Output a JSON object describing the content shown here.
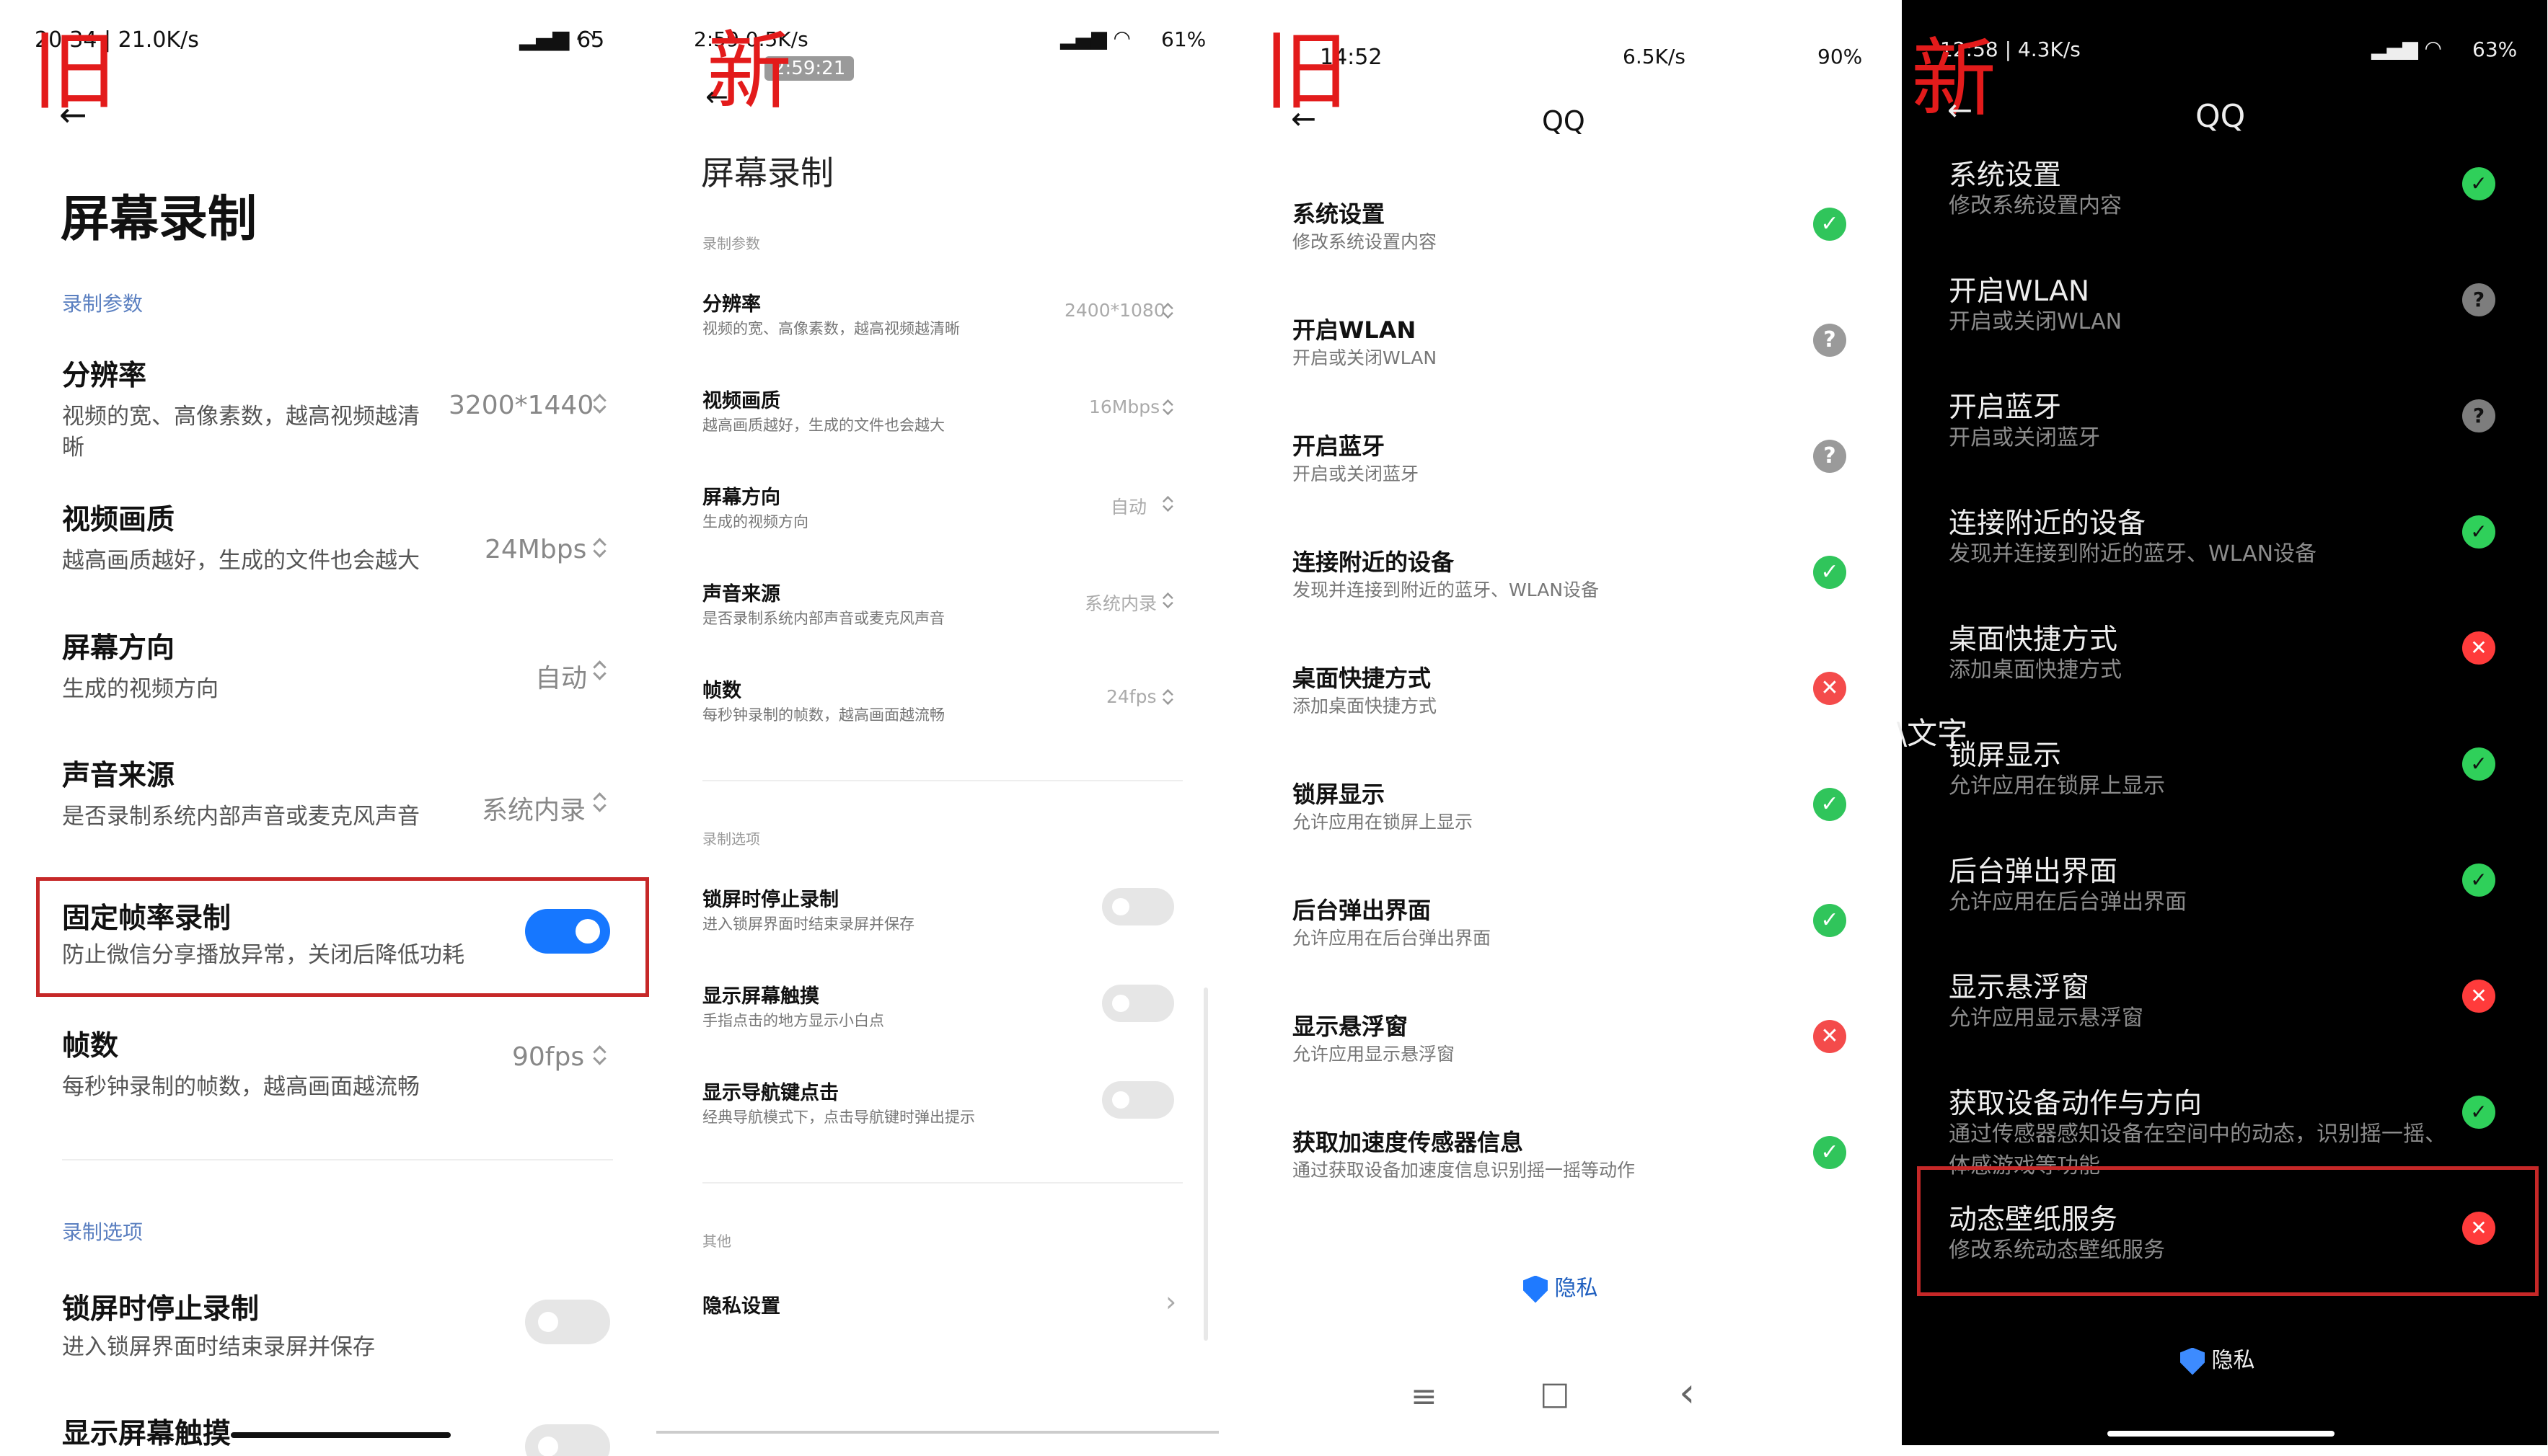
{
  "p1": {
    "tag": "旧",
    "status_left": "20:34 | 21.0K/s",
    "status_right": "65",
    "title": "屏幕录制",
    "section1": "录制参数",
    "rows": [
      {
        "h": "分辨率",
        "d1": "视频的宽、高像素数，越高视频越清",
        "d2": "晰",
        "v": "3200*1440"
      },
      {
        "h": "视频画质",
        "d1": "越高画质越好，生成的文件也会越大",
        "v": "24Mbps"
      },
      {
        "h": "屏幕方向",
        "d1": "生成的视频方向",
        "v": "自动"
      },
      {
        "h": "声音来源",
        "d1": "是否录制系统内部声音或麦克风声音",
        "v": "系统内录"
      },
      {
        "h": "固定帧率录制",
        "d1": "防止微信分享播放异常，关闭后降低功耗",
        "v": ""
      },
      {
        "h": "帧数",
        "d1": "每秒钟录制的帧数，越高画面越流畅",
        "v": "90fps"
      }
    ],
    "section2": "录制选项",
    "opt1_h": "锁屏时停止录制",
    "opt1_d": "进入锁屏界面时结束录屏并保存",
    "opt2_h": "显示屏幕触摸"
  },
  "p2": {
    "tag": "新",
    "status_left": "2:59 0.5K/s",
    "time_overlay": "2:59:21",
    "status_right": "61%",
    "title": "屏幕录制",
    "section1": "录制参数",
    "rows": [
      {
        "h": "分辨率",
        "d": "视频的宽、高像素数，越高视频越清晰",
        "v": "2400*1080"
      },
      {
        "h": "视频画质",
        "d": "越高画质越好，生成的文件也会越大",
        "v": "16Mbps"
      },
      {
        "h": "屏幕方向",
        "d": "生成的视频方向",
        "v": "自动"
      },
      {
        "h": "声音来源",
        "d": "是否录制系统内部声音或麦克风声音",
        "v": "系统内录"
      },
      {
        "h": "帧数",
        "d": "每秒钟录制的帧数，越高画面越流畅",
        "v": "24fps"
      }
    ],
    "section2": "录制选项",
    "opts": [
      {
        "h": "锁屏时停止录制",
        "d": "进入锁屏界面时结束录屏并保存"
      },
      {
        "h": "显示屏幕触摸",
        "d": "手指点击的地方显示小白点"
      },
      {
        "h": "显示导航键点击",
        "d": "经典导航模式下，点击导航键时弹出提示"
      }
    ],
    "section3": "其他",
    "privacy": "隐私设置"
  },
  "p3": {
    "tag": "旧",
    "time": "14:52",
    "status_right": "6.5K/s",
    "battery": "90%",
    "title": "QQ",
    "rows": [
      {
        "h": "系统设置",
        "d": "修改系统设置内容",
        "s": "ok"
      },
      {
        "h": "开启WLAN",
        "d": "开启或关闭WLAN",
        "s": "qm"
      },
      {
        "h": "开启蓝牙",
        "d": "开启或关闭蓝牙",
        "s": "qm"
      },
      {
        "h": "连接附近的设备",
        "d": "发现并连接到附近的蓝牙、WLAN设备",
        "s": "ok"
      },
      {
        "h": "桌面快捷方式",
        "d": "添加桌面快捷方式",
        "s": "no"
      },
      {
        "h": "锁屏显示",
        "d": "允许应用在锁屏上显示",
        "s": "ok"
      },
      {
        "h": "后台弹出界面",
        "d": "允许应用在后台弹出界面",
        "s": "ok"
      },
      {
        "h": "显示悬浮窗",
        "d": "允许应用显示悬浮窗",
        "s": "no"
      },
      {
        "h": "获取加速度传感器信息",
        "d": "通过获取设备加速度信息识别摇一摇等动作",
        "s": "ok"
      }
    ],
    "privacy": "隐私"
  },
  "p4": {
    "tag": "新",
    "status_left": "12:58 | 4.3K/s",
    "battery": "63%",
    "title": "QQ",
    "overlay_text": "\\文字",
    "rows": [
      {
        "h": "系统设置",
        "d": "修改系统设置内容",
        "s": "ok"
      },
      {
        "h": "开启WLAN",
        "d": "开启或关闭WLAN",
        "s": "qm"
      },
      {
        "h": "开启蓝牙",
        "d": "开启或关闭蓝牙",
        "s": "qm"
      },
      {
        "h": "连接附近的设备",
        "d": "发现并连接到附近的蓝牙、WLAN设备",
        "s": "ok"
      },
      {
        "h": "桌面快捷方式",
        "d": "添加桌面快捷方式",
        "s": "no"
      },
      {
        "h": "锁屏显示",
        "d": "允许应用在锁屏上显示",
        "s": "ok"
      },
      {
        "h": "后台弹出界面",
        "d": "允许应用在后台弹出界面",
        "s": "ok"
      },
      {
        "h": "显示悬浮窗",
        "d": "允许应用显示悬浮窗",
        "s": "no"
      },
      {
        "h": "获取设备动作与方向",
        "d": "通过传感器感知设备在空间中的动态，识别摇一摇、",
        "d2": "体感游戏等功能",
        "s": "ok"
      },
      {
        "h": "动态壁纸服务",
        "d": "修改系统动态壁纸服务",
        "s": "no"
      }
    ],
    "privacy": "隐私"
  },
  "icons": {
    "check": "✓",
    "cross": "✕",
    "question": "?",
    "back": "←",
    "chev_right": "›",
    "nav_menu": "≡",
    "nav_home": "□",
    "nav_back": "‹"
  },
  "colors": {
    "tag": "#e31b1b",
    "accent": "#1677ff",
    "ok": "#30c55b",
    "no": "#f44b4b",
    "highlight_box": "#c62828"
  }
}
